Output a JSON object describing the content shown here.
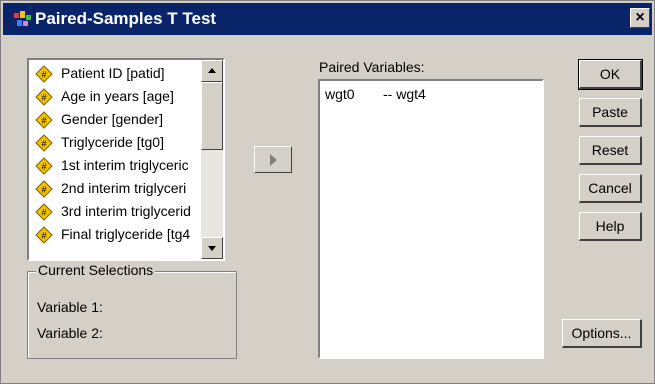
{
  "window": {
    "title": "Paired-Samples T Test",
    "close_glyph": "×"
  },
  "variables": [
    "Patient ID [patid]",
    "Age in years [age]",
    "Gender [gender]",
    "Triglyceride [tg0]",
    "1st interim triglyceric",
    "2nd interim triglyceri",
    "3rd interim triglycerid",
    "Final triglyceride [tg4"
  ],
  "current_selections": {
    "legend": "Current Selections",
    "variable1_label": "Variable 1:",
    "variable2_label": "Variable 2:"
  },
  "paired": {
    "label": "Paired Variables:",
    "pairs": [
      {
        "first": "wgt0",
        "second": "-- wgt4"
      }
    ]
  },
  "buttons": {
    "ok": "OK",
    "paste": "Paste",
    "reset": "Reset",
    "cancel": "Cancel",
    "help": "Help",
    "options": "Options..."
  },
  "colors": {
    "title_bar": "#0a246a",
    "dialog_bg": "#d4d0c8",
    "var_icon": "#f2c200"
  }
}
